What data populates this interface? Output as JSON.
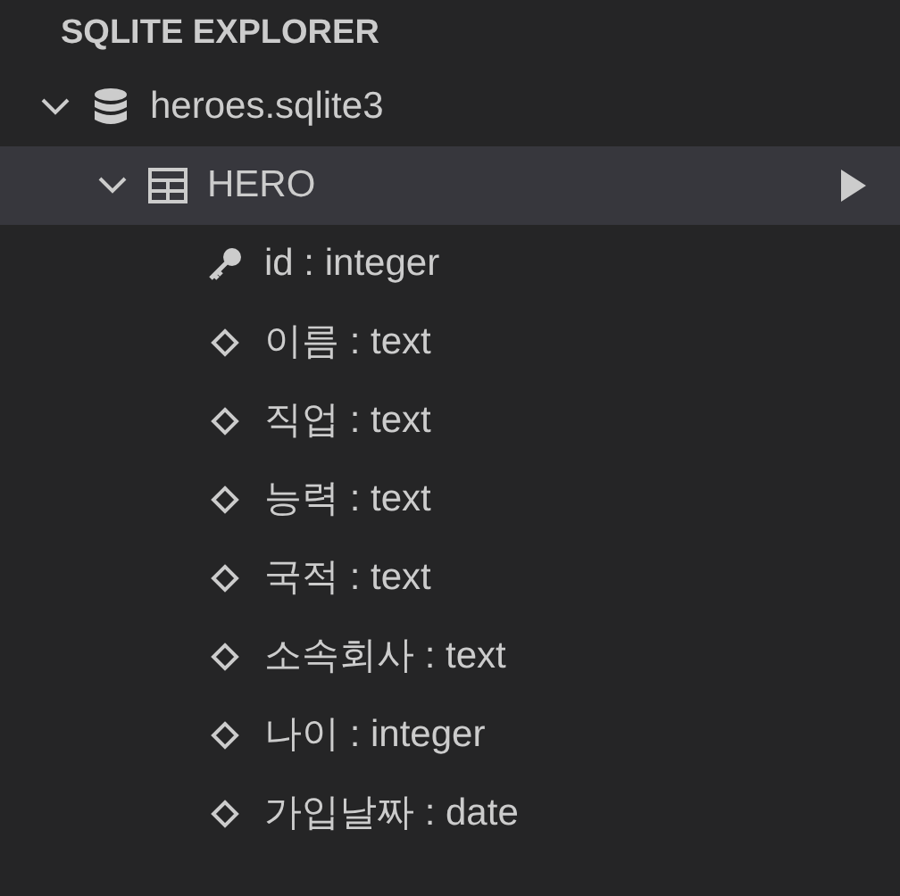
{
  "panel": {
    "title": "SQLITE EXPLORER"
  },
  "tree": [
    {
      "label": "heroes.sqlite3",
      "kind": "database",
      "expanded": true,
      "selected": false,
      "children": [
        {
          "label": "HERO",
          "kind": "table",
          "expanded": true,
          "selected": true,
          "children": [
            {
              "label": "id : integer",
              "kind": "key_column",
              "selected": false
            },
            {
              "label": "이름 : text",
              "kind": "column",
              "selected": false
            },
            {
              "label": "직업 : text",
              "kind": "column",
              "selected": false
            },
            {
              "label": "능력 : text",
              "kind": "column",
              "selected": false
            },
            {
              "label": "국적 : text",
              "kind": "column",
              "selected": false
            },
            {
              "label": "소속회사 : text",
              "kind": "column",
              "selected": false
            },
            {
              "label": "나이 : integer",
              "kind": "column",
              "selected": false
            },
            {
              "label": "가입날짜 : date",
              "kind": "column",
              "selected": false
            }
          ]
        }
      ]
    }
  ]
}
